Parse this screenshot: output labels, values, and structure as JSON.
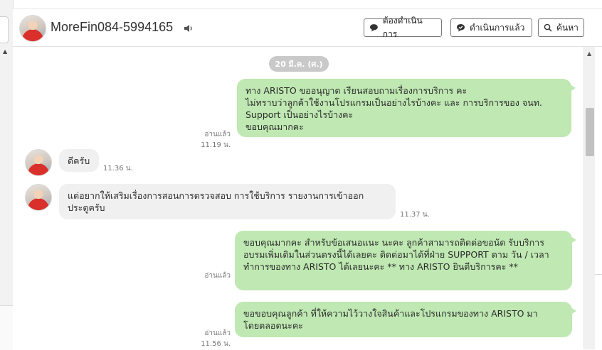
{
  "header": {
    "contact_name": "MoreFin084-5994165",
    "buttons": {
      "todo": "ต้องดำเนินการ",
      "done": "ดำเนินการแล้ว",
      "search": "ค้นหา"
    }
  },
  "chat": {
    "date_label": "20 มี.ค. (ศ.)",
    "messages": [
      {
        "direction": "out",
        "text": "ทาง ARISTO ขออนุญาต เรียนสอบถามเรื่องการบริการ คะ\nไม่ทราบว่าลูกค้าใช้งานโปรแกรมเป็นอย่างไรบ้างคะ และ  การบริการของ จนท.\nSupport เป็นอย่างไรบ้างคะ\nขอบคุณมากคะ",
        "read": "อ่านแล้ว",
        "time": "11.19 น."
      },
      {
        "direction": "in",
        "text": "ดีครับ",
        "time": "11.36 น."
      },
      {
        "direction": "in",
        "text": "แต่อยากให้เสริมเรื่องการสอนการตรวจสอบ การใช้บริการ รายงานการเข้าออก\nประตูครับ",
        "time": "11.37 น."
      },
      {
        "direction": "out",
        "text": "ขอบคุณมากคะ สำหรับข้อเสนอแนะ นะคะ  ลูกค้าสามารถติดต่อขอนัด รับบริการ\nอบรมเพิ่มเติมในส่วนตรงนี้ได้เลยคะ ติดต่อมาได้ที่ฝ่าย SUPPORT ตาม วัน / เวลา\nทำการของทาง ARISTO ได้เลยนะคะ  ** ทาง ARISTO ยินดีบริการคะ **",
        "read": "อ่านแล้ว",
        "time": ""
      },
      {
        "direction": "out",
        "text": "ขอขอบคุณลูกค้า ที่ให้ความไว้วางใจสินค้าและโปรแกรมของทาง ARISTO มา\nโดยตลอดนะคะ",
        "read": "อ่านแล้ว",
        "time": "11.56 น."
      }
    ]
  },
  "colors": {
    "outgoing_bubble": "#bfe8b2",
    "incoming_bubble": "#f0f0f0",
    "date_pill": "#c9c9c9"
  },
  "icons": [
    "speaker-icon",
    "chat-bubble-icon",
    "check-chat-icon",
    "search-icon",
    "scroll-up-arrow-icon",
    "avatar"
  ]
}
